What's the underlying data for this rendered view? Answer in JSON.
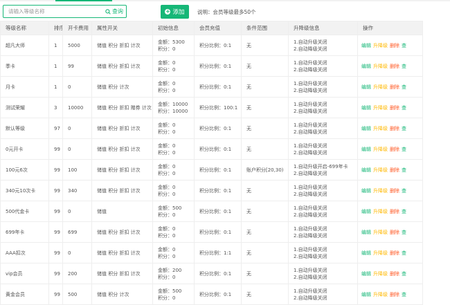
{
  "search": {
    "placeholder": "请输入等级名称",
    "button_label": "查询"
  },
  "toolbar": {
    "add_label": "添加",
    "note": "说明：会员等级最多50个"
  },
  "columns": [
    "等级名称",
    "排序",
    "开卡费用",
    "属性开关",
    "初始信息",
    "会员充值",
    "条件范围",
    "升降级信息",
    "操作"
  ],
  "ops": {
    "edit": "编辑",
    "level": "升降级",
    "delete": "删除",
    "more": "查"
  },
  "rows": [
    {
      "name": "超凡大师",
      "sort": "1",
      "fee": "5000",
      "attrs": "储值 积分 折扣 计次",
      "init1": "金额：5300",
      "init2": "积分：0",
      "charge": "积分比例：0:1",
      "range": "无",
      "lv1": "1.自动升级关闭",
      "lv2": "2.自动降级关闭"
    },
    {
      "name": "季卡",
      "sort": "1",
      "fee": "99",
      "attrs": "储值 积分 折扣 计次",
      "init1": "金额：0",
      "init2": "积分：0",
      "charge": "积分比例：0:1",
      "range": "无",
      "lv1": "1.自动升级关闭",
      "lv2": "2.自动降级关闭"
    },
    {
      "name": "月卡",
      "sort": "1",
      "fee": "0",
      "attrs": "储值 积分 计次",
      "init1": "金额：0",
      "init2": "积分：0",
      "charge": "积分比例：0:1",
      "range": "无",
      "lv1": "1.自动升级关闭",
      "lv2": "2.自动降级关闭"
    },
    {
      "name": "测试荣耀",
      "sort": "3",
      "fee": "10000",
      "attrs": "储值 积分 折扣 赠券 计次",
      "init1": "金额：10000",
      "init2": "积分：10000",
      "charge": "积分比例：100:1",
      "range": "无",
      "lv1": "1.自动升级关闭",
      "lv2": "2.自动降级关闭"
    },
    {
      "name": "默认等级",
      "sort": "97",
      "fee": "0",
      "attrs": "储值 积分 折扣 计次",
      "init1": "金额：0",
      "init2": "积分：0",
      "charge": "积分比例：0:1",
      "range": "无",
      "lv1": "1.自动升级关闭",
      "lv2": "2.自动降级关闭"
    },
    {
      "name": "0元开卡",
      "sort": "99",
      "fee": "0",
      "attrs": "储值 积分 折扣 计次",
      "init1": "金额：0",
      "init2": "积分：0",
      "charge": "积分比例：0:1",
      "range": "无",
      "lv1": "1.自动升级关闭",
      "lv2": "2.自动降级关闭"
    },
    {
      "name": "100元6次",
      "sort": "99",
      "fee": "100",
      "attrs": "储值 积分 折扣 计次",
      "init1": "金额：0",
      "init2": "积分：0",
      "charge": "积分比例：0:1",
      "range": "账户积分[20,30)",
      "lv1": "1.自动升级开启-699年卡",
      "lv2": "2.自动降级关闭"
    },
    {
      "name": "340元10次卡",
      "sort": "99",
      "fee": "340",
      "attrs": "储值 积分 折扣 计次",
      "init1": "金额：0",
      "init2": "积分：0",
      "charge": "积分比例：0:1",
      "range": "无",
      "lv1": "1.自动升级关闭",
      "lv2": "2.自动降级关闭"
    },
    {
      "name": "500代金卡",
      "sort": "99",
      "fee": "0",
      "attrs": "储值",
      "init1": "金额：500",
      "init2": "积分：0",
      "charge": "积分比例：0:1",
      "range": "无",
      "lv1": "1.自动升级关闭",
      "lv2": "2.自动降级关闭"
    },
    {
      "name": "699年卡",
      "sort": "99",
      "fee": "699",
      "attrs": "储值 积分 折扣 计次",
      "init1": "金额：0",
      "init2": "积分：0",
      "charge": "积分比例：0:1",
      "range": "无",
      "lv1": "1.自动升级关闭",
      "lv2": "2.自动降级关闭"
    },
    {
      "name": "AAA扣次",
      "sort": "99",
      "fee": "0",
      "attrs": "储值 积分 折扣 计次",
      "init1": "金额：0",
      "init2": "积分：0",
      "charge": "积分比例：1:1",
      "range": "无",
      "lv1": "1.自动升级关闭",
      "lv2": "2.自动降级关闭"
    },
    {
      "name": "vip会员",
      "sort": "99",
      "fee": "200",
      "attrs": "储值 积分 折扣 计次",
      "init1": "金额：200",
      "init2": "积分：0",
      "charge": "积分比例：0:1",
      "range": "无",
      "lv1": "1.自动升级关闭",
      "lv2": "2.自动降级关闭"
    },
    {
      "name": "黄金会员",
      "sort": "99",
      "fee": "500",
      "attrs": "储值 积分 计次",
      "init1": "金额：500",
      "init2": "积分：0",
      "charge": "积分比例：0:1",
      "range": "无",
      "lv1": "1.自动升级关闭",
      "lv2": "2.自动降级关闭"
    }
  ]
}
